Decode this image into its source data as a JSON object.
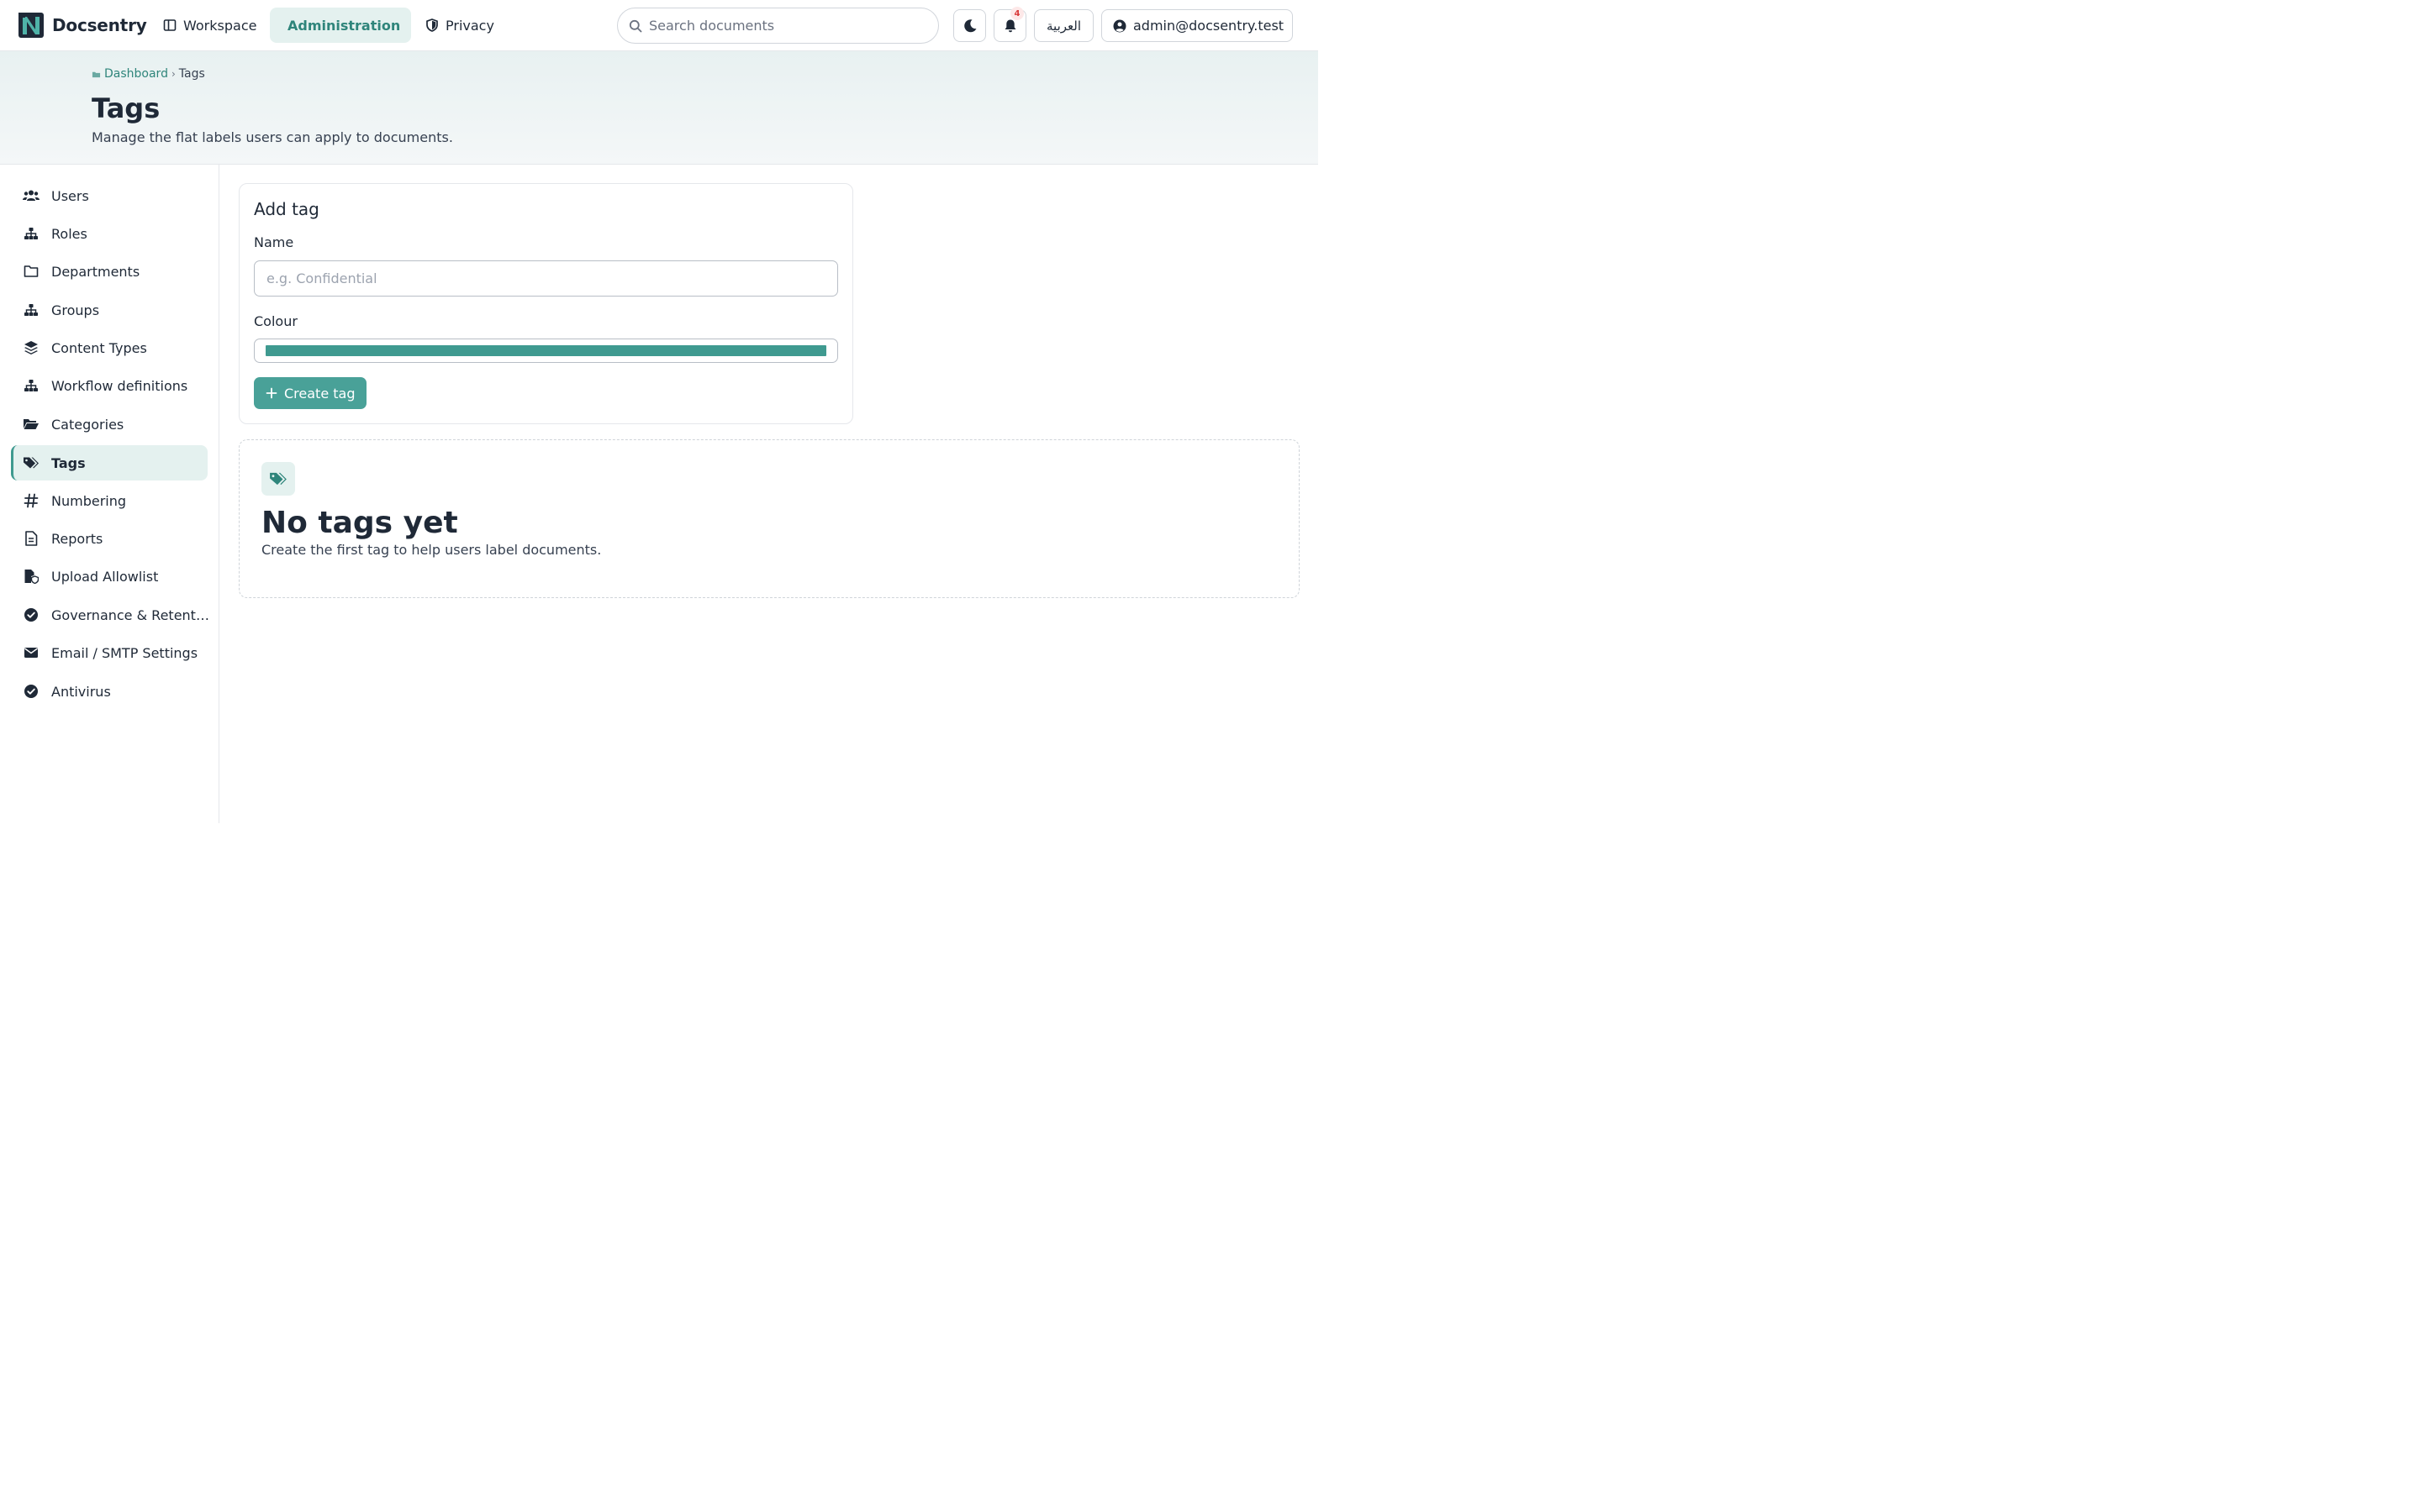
{
  "app": {
    "name": "Docsentry"
  },
  "nav": {
    "workspace": "Workspace",
    "administration": "Administration",
    "privacy": "Privacy"
  },
  "search": {
    "placeholder": "Search documents"
  },
  "notifications": {
    "count": "4"
  },
  "language_button": "العربية",
  "user": {
    "email": "admin@docsentry.test"
  },
  "breadcrumb": {
    "parent": "Dashboard",
    "current": "Tags"
  },
  "page": {
    "title": "Tags",
    "subtitle": "Manage the flat labels users can apply to documents."
  },
  "sidebar": {
    "items": [
      {
        "label": "Users",
        "icon": "users-icon"
      },
      {
        "label": "Roles",
        "icon": "hierarchy-icon"
      },
      {
        "label": "Departments",
        "icon": "folder-outline-icon"
      },
      {
        "label": "Groups",
        "icon": "hierarchy-icon"
      },
      {
        "label": "Content Types",
        "icon": "layers-icon"
      },
      {
        "label": "Workflow definitions",
        "icon": "hierarchy-icon"
      },
      {
        "label": "Categories",
        "icon": "folder-open-icon"
      },
      {
        "label": "Tags",
        "icon": "tags-icon",
        "active": true
      },
      {
        "label": "Numbering",
        "icon": "hashtag-icon"
      },
      {
        "label": "Reports",
        "icon": "file-icon"
      },
      {
        "label": "Upload Allowlist",
        "icon": "file-shield-icon"
      },
      {
        "label": "Governance & Retent…",
        "icon": "check-circle-icon"
      },
      {
        "label": "Email / SMTP Settings",
        "icon": "envelope-icon"
      },
      {
        "label": "Antivirus",
        "icon": "check-circle-icon"
      }
    ]
  },
  "form": {
    "title": "Add tag",
    "name_label": "Name",
    "name_placeholder": "e.g. Confidential",
    "name_value": "",
    "colour_label": "Colour",
    "colour_value": "#3f9a90",
    "submit_label": "Create tag"
  },
  "empty_state": {
    "title": "No tags yet",
    "message": "Create the first tag to help users label documents."
  },
  "colors": {
    "accent": "#49a198",
    "accent_dark": "#2f857b",
    "accent_soft": "#e4f1ef",
    "badge": "#d93b3b"
  }
}
